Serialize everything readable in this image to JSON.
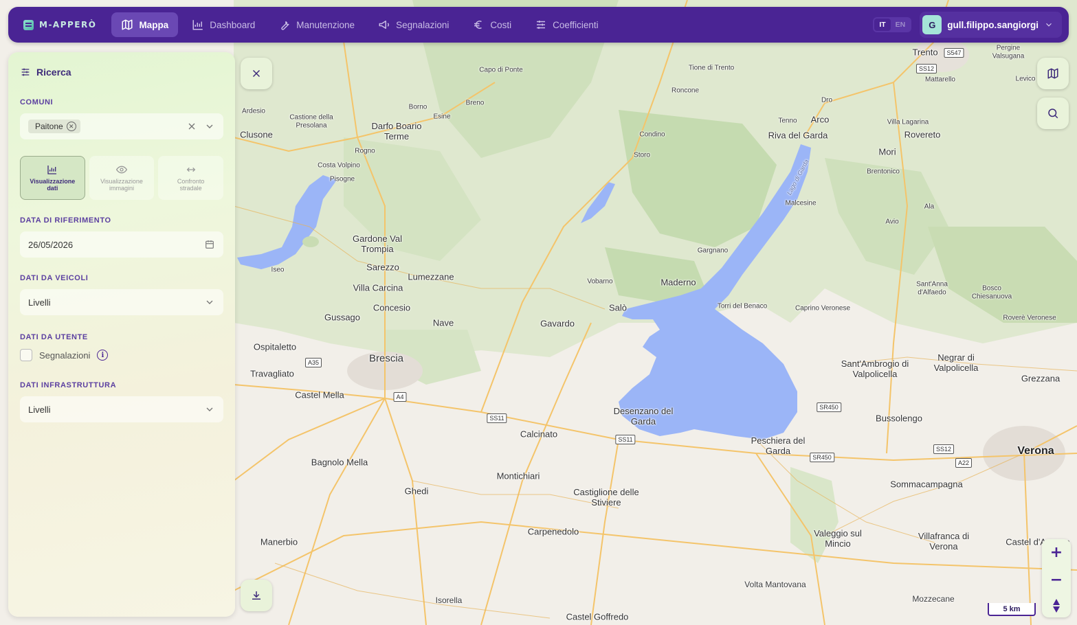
{
  "app": {
    "logo_text": "M-APPERÒ",
    "nav": [
      {
        "label": "Mappa",
        "icon": "map-icon",
        "active": true
      },
      {
        "label": "Dashboard",
        "icon": "bar-chart-icon",
        "active": false
      },
      {
        "label": "Manutenzione",
        "icon": "wrench-icon",
        "active": false
      },
      {
        "label": "Segnalazioni",
        "icon": "megaphone-icon",
        "active": false
      },
      {
        "label": "Costi",
        "icon": "euro-icon",
        "active": false
      },
      {
        "label": "Coefficienti",
        "icon": "sliders-icon",
        "active": false
      }
    ],
    "languages": [
      "IT",
      "EN"
    ],
    "active_language": "IT",
    "user": {
      "initial": "G",
      "name": "gull.filippo.sangiorgi"
    },
    "colors": {
      "primary": "#4a2494",
      "accent": "#a5e4d8",
      "lake": "#9bb5f7"
    }
  },
  "panel": {
    "title": "Ricerca",
    "comuni": {
      "label": "COMUNI",
      "selected_chip": "Paitone"
    },
    "modes": [
      {
        "label": "Visualizzazione dati",
        "icon": "bar-chart-icon",
        "active": true
      },
      {
        "label": "Visualizzazione immagini",
        "icon": "eye-icon",
        "active": false
      },
      {
        "label": "Confronto stradale",
        "icon": "arrows-horizontal-icon",
        "active": false
      }
    ],
    "date": {
      "label": "DATA DI RIFERIMENTO",
      "value": "26/05/2026"
    },
    "vehicles": {
      "label": "DATI DA VEICOLI",
      "value": "Livelli"
    },
    "user_data": {
      "label": "DATI DA UTENTE",
      "checkbox_label": "Segnalazioni",
      "checked": false
    },
    "infrastructure": {
      "label": "DATI INFRASTRUTTURA",
      "value": "Livelli"
    }
  },
  "map": {
    "scale_label": "5 km",
    "zoom_in": "+",
    "zoom_out": "−",
    "places": [
      {
        "name": "Trento",
        "size": "med"
      },
      {
        "name": "Pergine Valsugana",
        "size": "small"
      },
      {
        "name": "Levico",
        "size": "small"
      },
      {
        "name": "Mattarello",
        "size": "small"
      },
      {
        "name": "Capo di Ponte",
        "size": "small"
      },
      {
        "name": "Tione di Trento",
        "size": "small"
      },
      {
        "name": "Roncone",
        "size": "small"
      },
      {
        "name": "Ardesio",
        "size": "small"
      },
      {
        "name": "Castione della Presolana",
        "size": "small"
      },
      {
        "name": "Borno",
        "size": "small"
      },
      {
        "name": "Breno",
        "size": "small"
      },
      {
        "name": "Esine",
        "size": "small"
      },
      {
        "name": "Darfo Boario Terme",
        "size": "med"
      },
      {
        "name": "Clusone",
        "size": "med"
      },
      {
        "name": "Dro",
        "size": "small"
      },
      {
        "name": "Tenno",
        "size": "small"
      },
      {
        "name": "Arco",
        "size": "med"
      },
      {
        "name": "Villa Lagarina",
        "size": "small"
      },
      {
        "name": "Riva del Garda",
        "size": "med"
      },
      {
        "name": "Rovereto",
        "size": "med"
      },
      {
        "name": "Condino",
        "size": "small"
      },
      {
        "name": "Storo",
        "size": "small"
      },
      {
        "name": "Rogno",
        "size": "small"
      },
      {
        "name": "Costa Volpino",
        "size": "small"
      },
      {
        "name": "Pisogne",
        "size": "small"
      },
      {
        "name": "Mori",
        "size": "med"
      },
      {
        "name": "Brentonico",
        "size": "small"
      },
      {
        "name": "Malcesine",
        "size": "small"
      },
      {
        "name": "Ala",
        "size": "small"
      },
      {
        "name": "Avio",
        "size": "small"
      },
      {
        "name": "Gardone Val Trompia",
        "size": "med"
      },
      {
        "name": "Gargnano",
        "size": "small"
      },
      {
        "name": "Iseo",
        "size": "small"
      },
      {
        "name": "Sarezzo",
        "size": "med"
      },
      {
        "name": "Lumezzane",
        "size": "med"
      },
      {
        "name": "Vobarno",
        "size": "small"
      },
      {
        "name": "Maderno",
        "size": "med"
      },
      {
        "name": "Sant'Anna d'Alfaedo",
        "size": "small"
      },
      {
        "name": "Bosco Chiesanuova",
        "size": "small"
      },
      {
        "name": "Villa Carcina",
        "size": "med"
      },
      {
        "name": "Torri del Benaco",
        "size": "small"
      },
      {
        "name": "Caprino Veronese",
        "size": "small"
      },
      {
        "name": "Concesio",
        "size": "med"
      },
      {
        "name": "Salò",
        "size": "med"
      },
      {
        "name": "Roverè Veronese",
        "size": "small"
      },
      {
        "name": "Gussago",
        "size": "med"
      },
      {
        "name": "Nave",
        "size": "med"
      },
      {
        "name": "Gavardo",
        "size": "med"
      },
      {
        "name": "Ospitaletto",
        "size": "med"
      },
      {
        "name": "Brescia",
        "size": "big"
      },
      {
        "name": "Sant'Ambrogio di Valpolicella",
        "size": "med"
      },
      {
        "name": "Negrar di Valpolicella",
        "size": "med"
      },
      {
        "name": "Travagliato",
        "size": "med"
      },
      {
        "name": "Grezzana",
        "size": "med"
      },
      {
        "name": "Castel Mella",
        "size": "med"
      },
      {
        "name": "Desenzano del Garda",
        "size": "med"
      },
      {
        "name": "Bussolengo",
        "size": "med"
      },
      {
        "name": "Calcinato",
        "size": "med"
      },
      {
        "name": "Peschiera del Garda",
        "size": "med"
      },
      {
        "name": "Verona",
        "size": "xl"
      },
      {
        "name": "Bagnolo Mella",
        "size": "med"
      },
      {
        "name": "Montichiari",
        "size": "med"
      },
      {
        "name": "Sommacampagna",
        "size": "med"
      },
      {
        "name": "Ghedi",
        "size": "med"
      },
      {
        "name": "Castiglione delle Stiviere",
        "size": "med"
      },
      {
        "name": "Carpenedolo",
        "size": "med"
      },
      {
        "name": "Valeggio sul Mincio",
        "size": "med"
      },
      {
        "name": "Villafranca di Verona",
        "size": "med"
      },
      {
        "name": "Manerbio",
        "size": "med"
      },
      {
        "name": "Castel d'Azzano",
        "size": "med"
      },
      {
        "name": "Volta Mantovana",
        "size": "small"
      },
      {
        "name": "Mozzecane",
        "size": "small"
      },
      {
        "name": "Isorella",
        "size": "small"
      },
      {
        "name": "Castel Goffredo",
        "size": "med"
      },
      {
        "name": "Lago di Garda",
        "size": "lake"
      }
    ],
    "road_shields": [
      "S547",
      "SS12",
      "A35",
      "A4",
      "SS11",
      "SS11",
      "SR450",
      "SR450",
      "SS12",
      "A22"
    ]
  }
}
